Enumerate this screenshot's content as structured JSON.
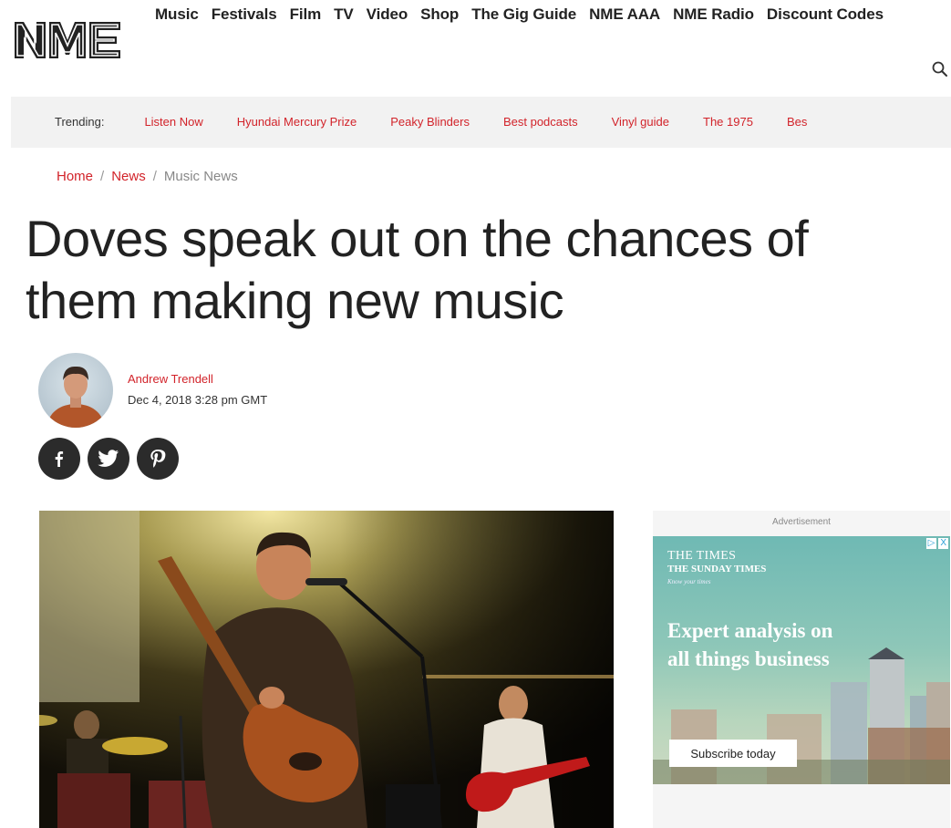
{
  "brand": {
    "logo_text": "NME"
  },
  "nav": {
    "items": [
      "Music",
      "Festivals",
      "Film",
      "TV",
      "Video",
      "Shop",
      "The Gig Guide",
      "NME AAA",
      "NME Radio",
      "Discount Codes"
    ]
  },
  "trending": {
    "label": "Trending:",
    "items": [
      "Listen Now",
      "Hyundai Mercury Prize",
      "Peaky Blinders",
      "Best podcasts",
      "Vinyl guide",
      "The 1975",
      "Bes"
    ]
  },
  "breadcrumb": {
    "home": "Home",
    "news": "News",
    "current": "Music News",
    "separator": "/"
  },
  "article": {
    "headline": "Doves speak out on the chances of them making new music",
    "author": "Andrew Trendell",
    "date": "Dec 4, 2018 3:28 pm GMT"
  },
  "share": {
    "icons": [
      "facebook-icon",
      "twitter-icon",
      "pinterest-icon"
    ]
  },
  "ad": {
    "label": "Advertisement",
    "logo_line1": "THE TIMES",
    "logo_line2": "THE SUNDAY TIMES",
    "tagline": "Know your times",
    "headline": "Expert analysis on all things business",
    "cta": "Subscribe today",
    "choices_icon": "▷",
    "close_icon": "X"
  },
  "colors": {
    "accent": "#d2232a",
    "text": "#222222",
    "trending_bg": "#f2f2f2",
    "share_bg": "#2b2b2b"
  }
}
